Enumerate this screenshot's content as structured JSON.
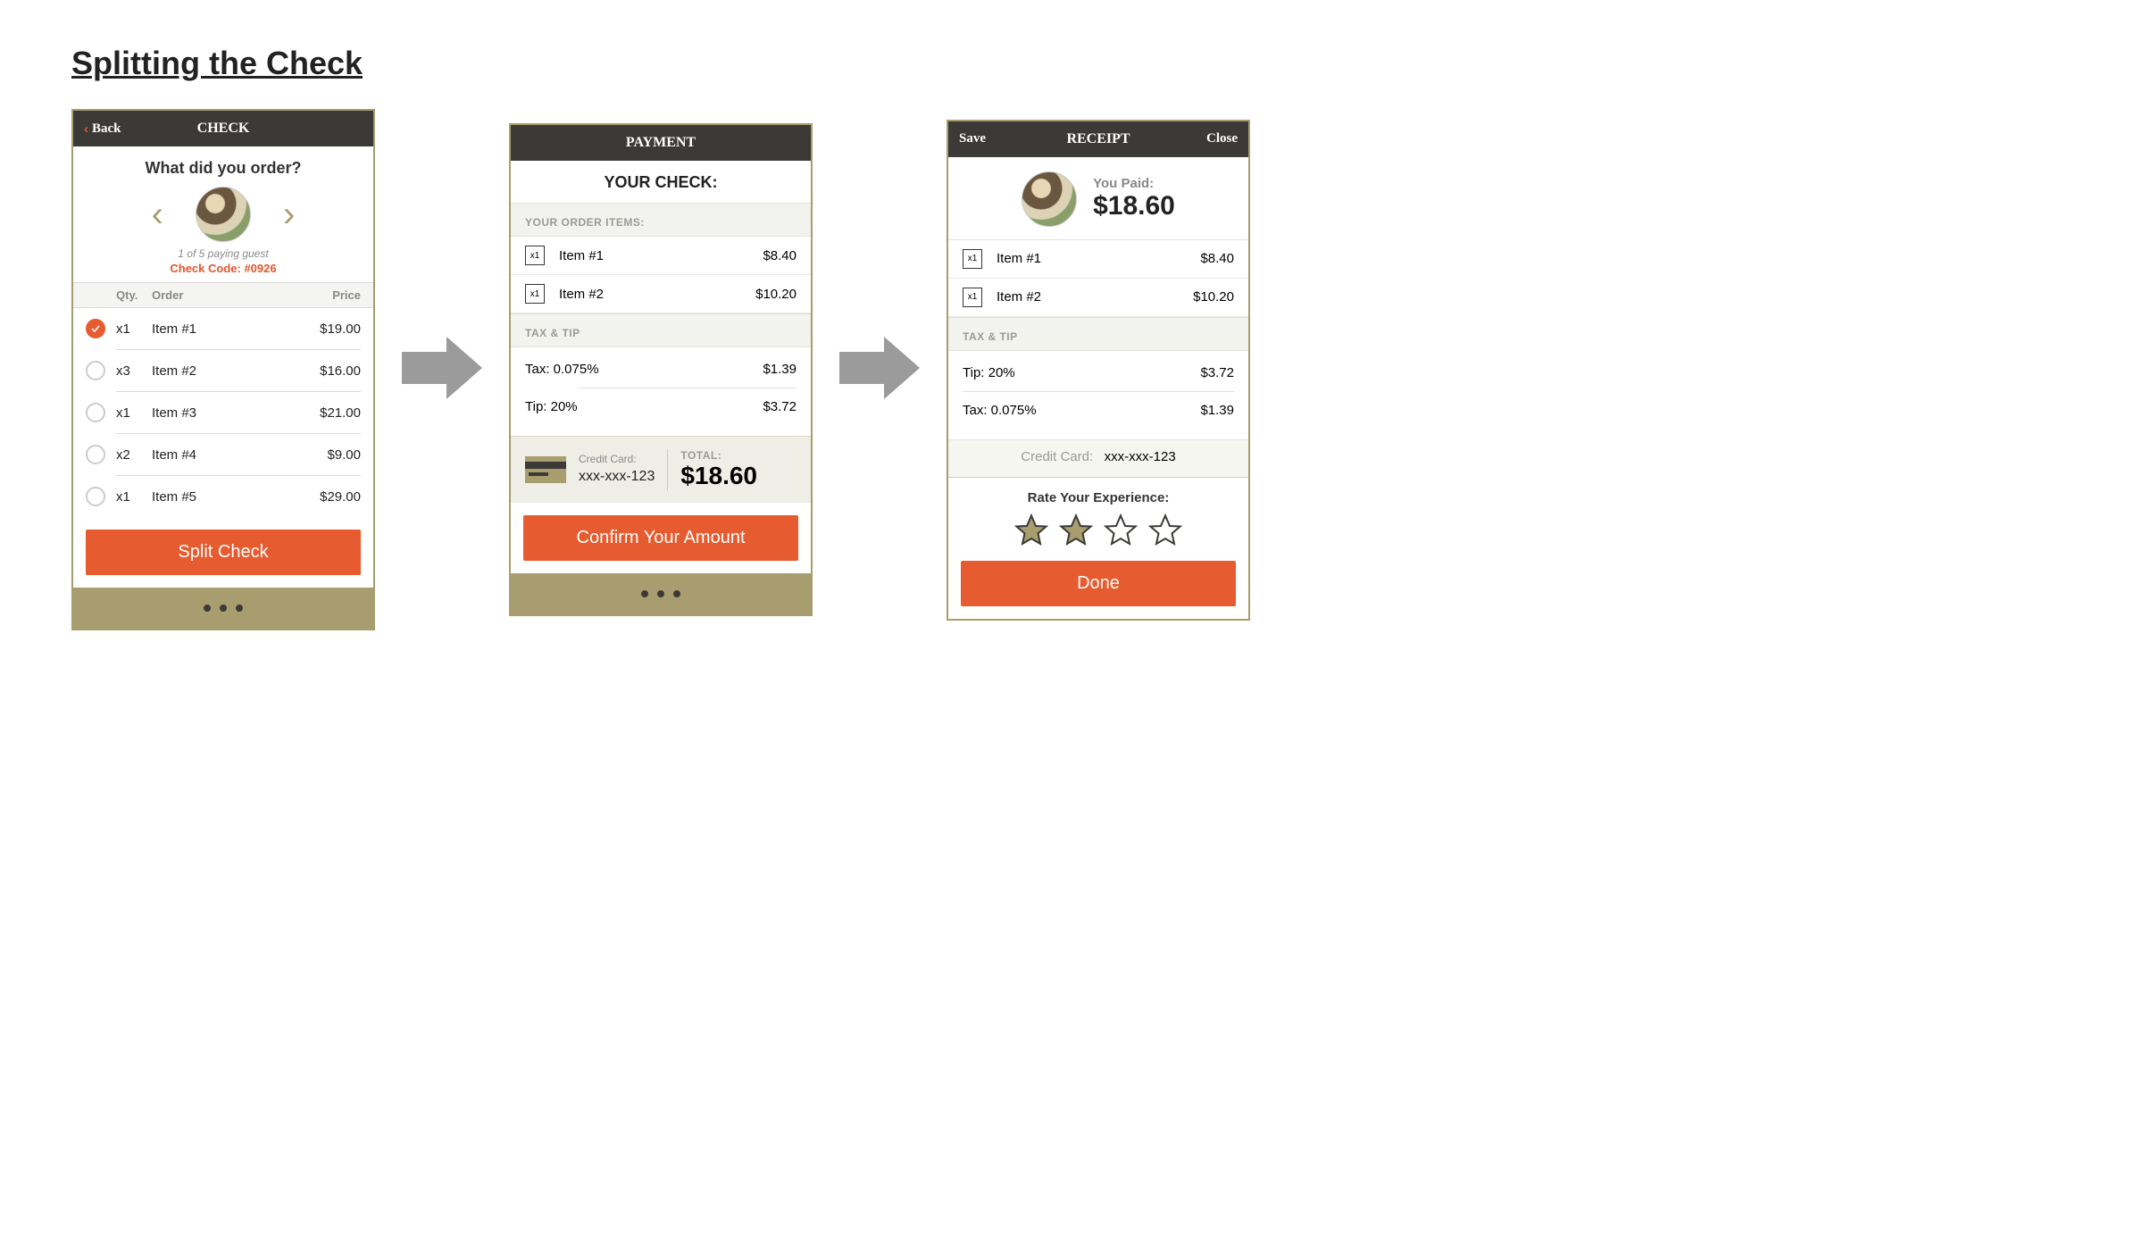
{
  "page_title": "Splitting the Check",
  "screen1": {
    "header_back": "Back",
    "header_title": "CHECK",
    "prompt": "What did you order?",
    "caption": "1 of 5 paying guest",
    "check_code": "Check Code: #0926",
    "col_qty": "Qty.",
    "col_order": "Order",
    "col_price": "Price",
    "items": [
      {
        "checked": true,
        "qty": "x1",
        "name": "Item #1",
        "price": "$19.00"
      },
      {
        "checked": false,
        "qty": "x3",
        "name": "Item #2",
        "price": "$16.00"
      },
      {
        "checked": false,
        "qty": "x1",
        "name": "Item #3",
        "price": "$21.00"
      },
      {
        "checked": false,
        "qty": "x2",
        "name": "Item #4",
        "price": "$9.00"
      },
      {
        "checked": false,
        "qty": "x1",
        "name": "Item #5",
        "price": "$29.00"
      }
    ],
    "button": "Split Check"
  },
  "screen2": {
    "header_title": "PAYMENT",
    "title": "YOUR CHECK:",
    "section_items": "YOUR ORDER ITEMS:",
    "items": [
      {
        "qty": "x1",
        "name": "Item #1",
        "price": "$8.40"
      },
      {
        "qty": "x1",
        "name": "Item #2",
        "price": "$10.20"
      }
    ],
    "section_taxtip": "TAX & TIP",
    "tax_label": "Tax: 0.075%",
    "tax_amount": "$1.39",
    "tip_label": "Tip: 20%",
    "tip_amount": "$3.72",
    "cc_label": "Credit Card:",
    "cc_number": "xxx-xxx-123",
    "total_label": "TOTAL:",
    "total_amount": "$18.60",
    "button": "Confirm Your Amount"
  },
  "screen3": {
    "header_save": "Save",
    "header_title": "RECEIPT",
    "header_close": "Close",
    "paid_label": "You Paid:",
    "paid_amount": "$18.60",
    "items": [
      {
        "qty": "x1",
        "name": "Item #1",
        "price": "$8.40"
      },
      {
        "qty": "x1",
        "name": "Item #2",
        "price": "$10.20"
      }
    ],
    "section_taxtip": "TAX & TIP",
    "tip_label": "Tip: 20%",
    "tip_amount": "$3.72",
    "tax_label": "Tax: 0.075%",
    "tax_amount": "$1.39",
    "cc_label": "Credit Card:",
    "cc_number": "xxx-xxx-123",
    "rate_label": "Rate Your Experience:",
    "stars_filled": 2,
    "stars_total": 4,
    "button": "Done"
  }
}
